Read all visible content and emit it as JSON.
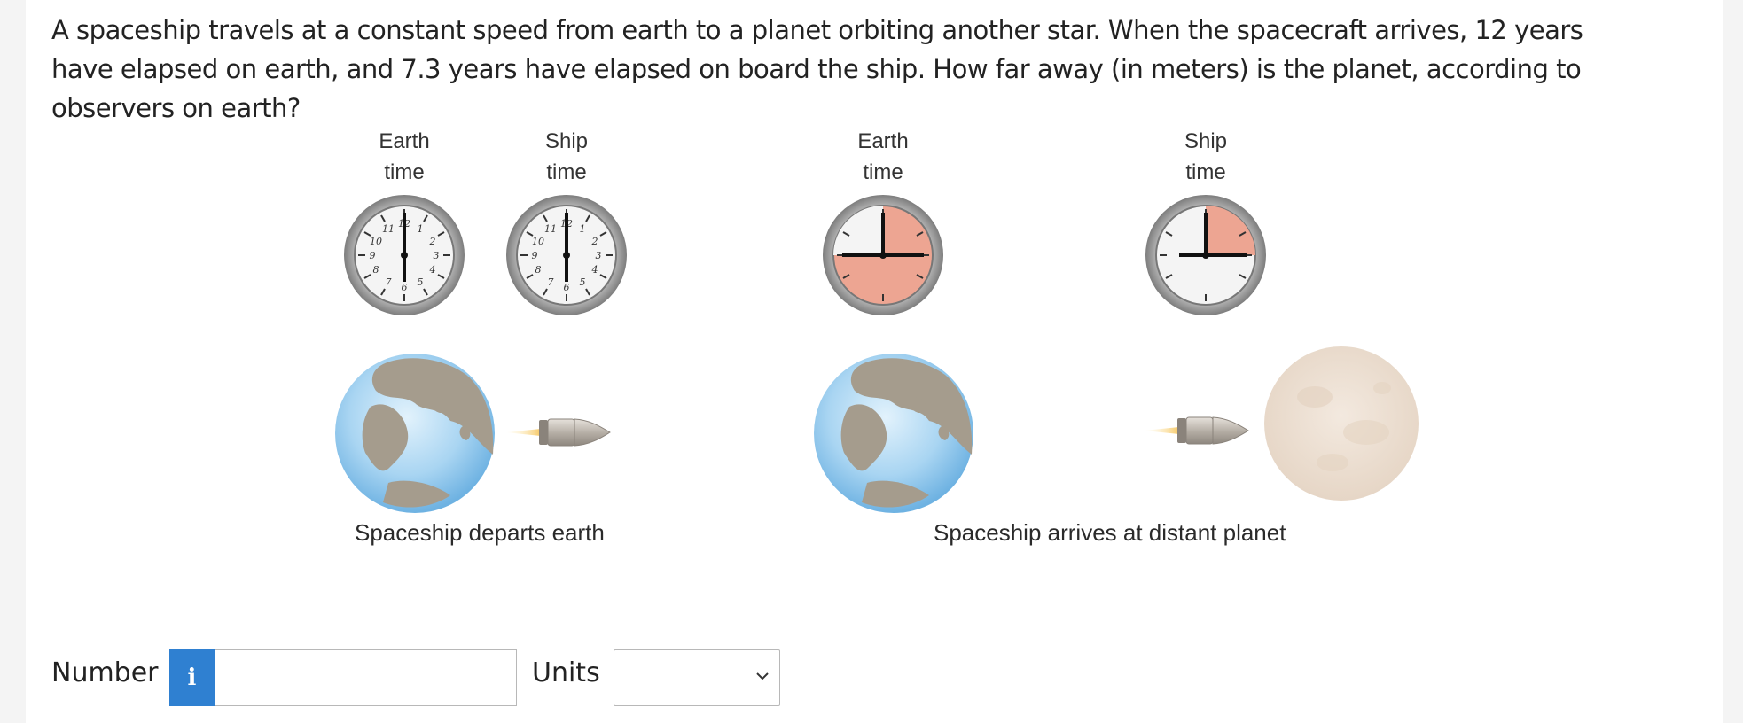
{
  "question": {
    "text": "A spaceship travels at a constant speed from earth to a planet orbiting another star. When the spacecraft arrives, 12 years have elapsed on earth, and 7.3 years have elapsed on board the ship. How far away (in meters) is the planet, according to observers on earth?"
  },
  "figure": {
    "left": {
      "clock1_label_line1": "Earth",
      "clock1_label_line2": "time",
      "clock2_label_line1": "Ship",
      "clock2_label_line2": "time",
      "caption": "Spaceship departs earth"
    },
    "right": {
      "clock1_label_line1": "Earth",
      "clock1_label_line2": "time",
      "clock2_label_line1": "Ship",
      "clock2_label_line2": "time",
      "caption": "Spaceship arrives at distant planet"
    }
  },
  "answer": {
    "number_label": "Number",
    "info_icon": "i",
    "number_value": "",
    "units_label": "Units",
    "units_selected": ""
  },
  "colors": {
    "accent": "#2f80d1",
    "clock_sector": "#eda592",
    "earth_ocean": "#a8d4f0",
    "earth_land": "#a59c8d",
    "planet": "#efe3d6"
  }
}
